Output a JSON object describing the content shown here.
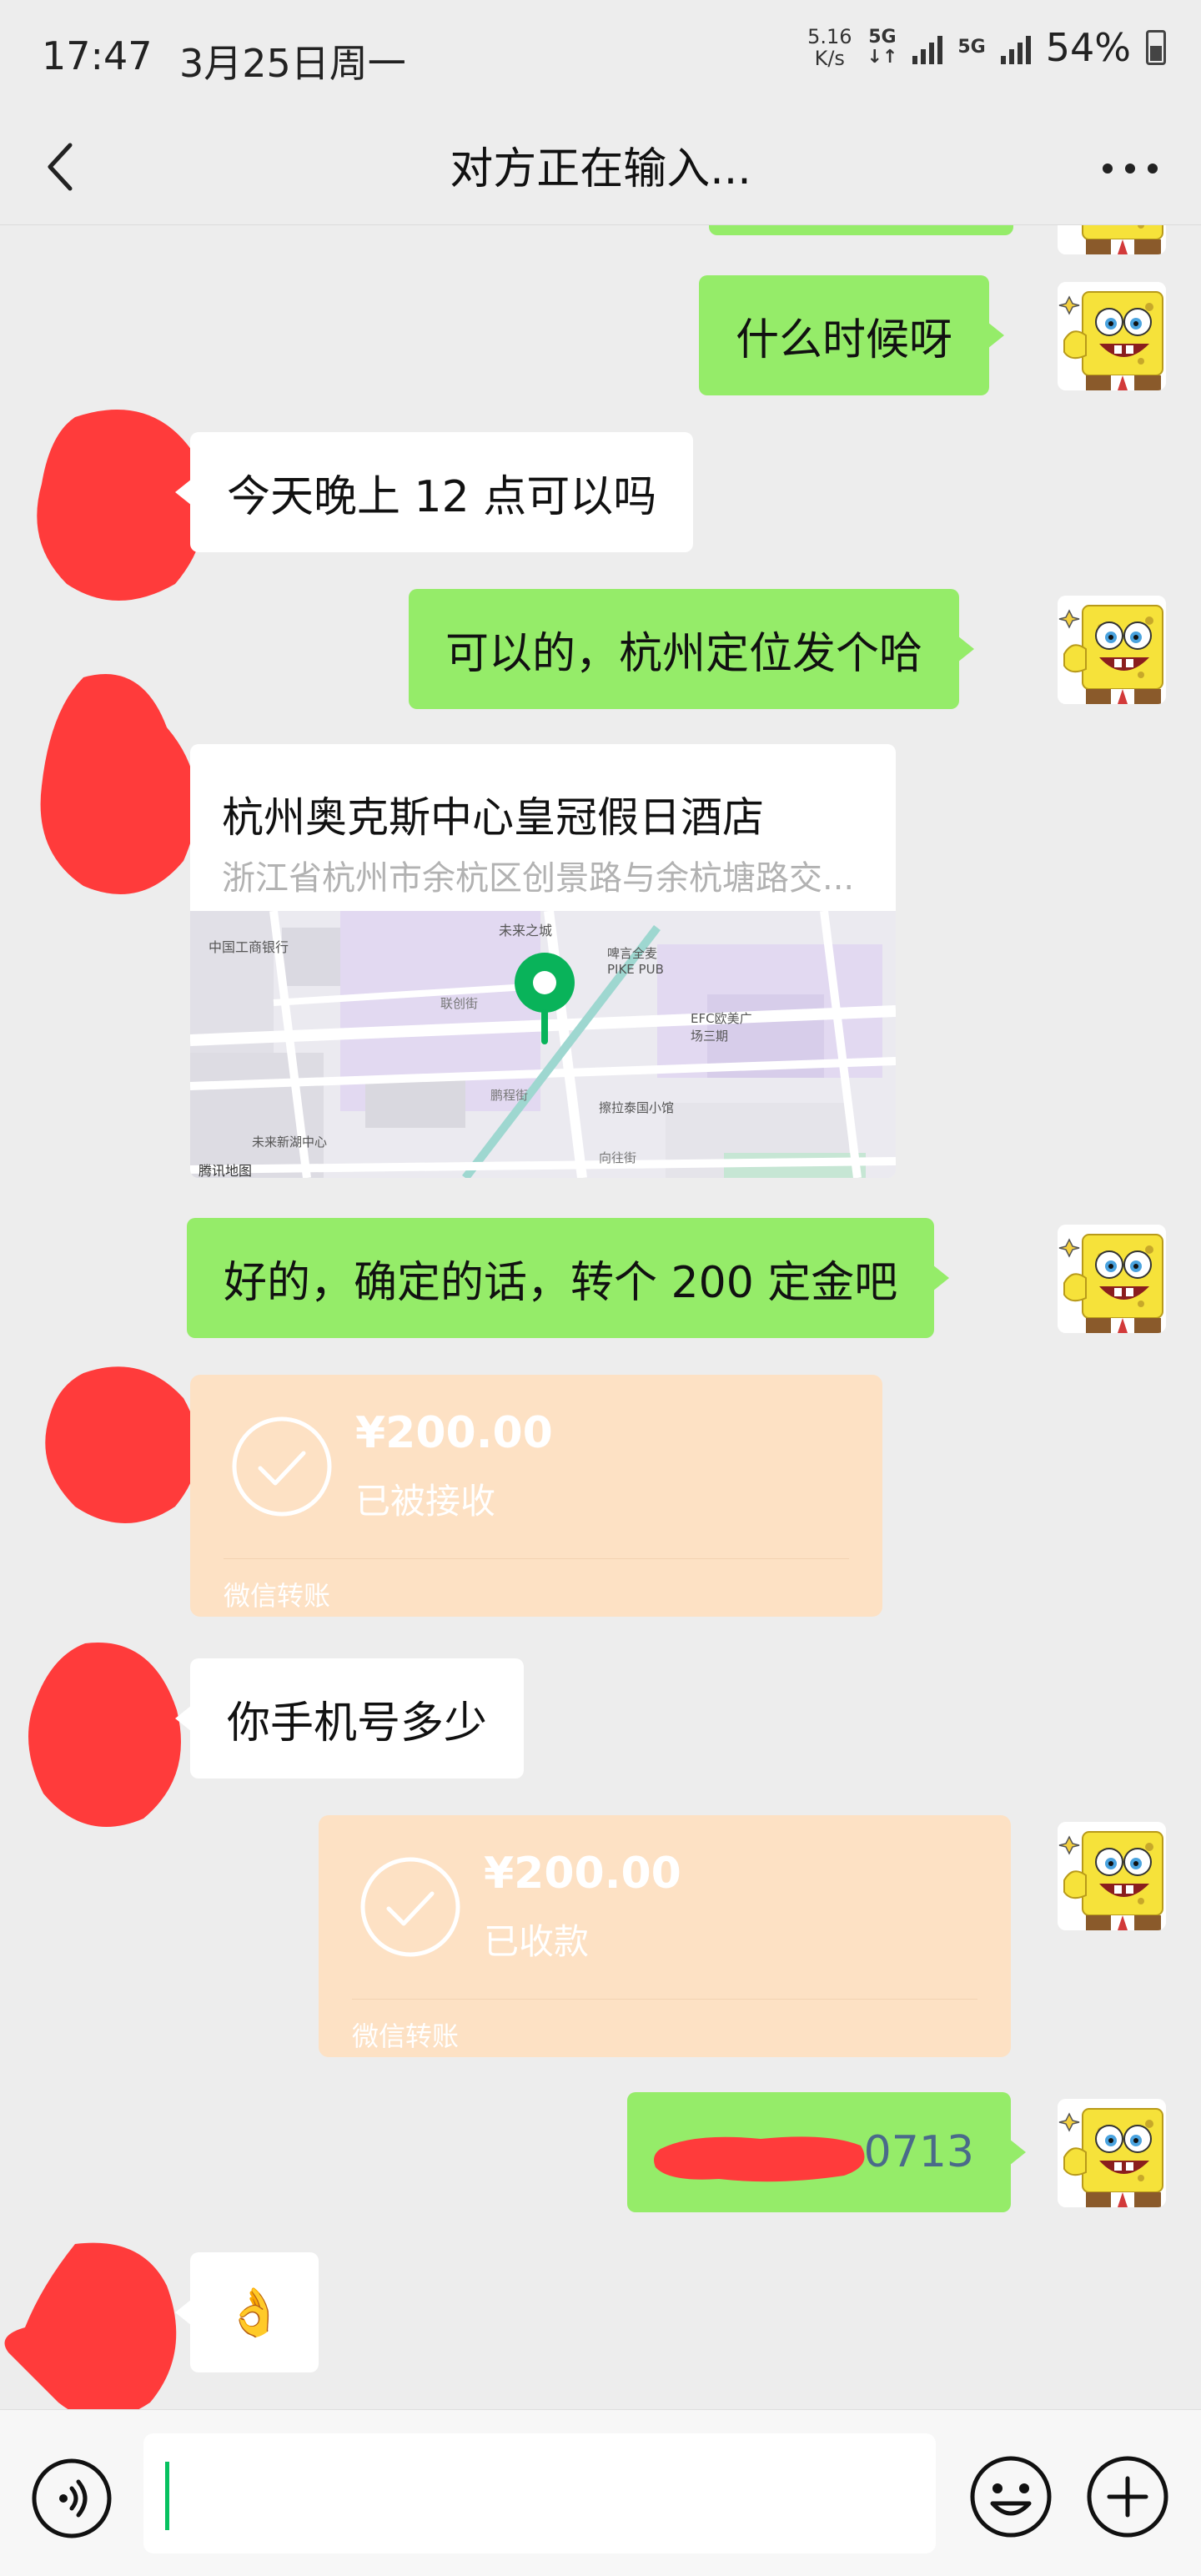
{
  "status_bar": {
    "time": "17:47",
    "date": "3月25日周一",
    "net_speed_value": "5.16",
    "net_speed_unit": "K/s",
    "network_1": "5G",
    "network_2": "5G",
    "battery": "54%"
  },
  "header": {
    "title": "对方正在输入..."
  },
  "messages": [
    {
      "side": "right",
      "type": "text",
      "text": "什么时候呀"
    },
    {
      "side": "left",
      "type": "text",
      "text": "今天晚上 12 点可以吗"
    },
    {
      "side": "right",
      "type": "text",
      "text": "可以的，杭州定位发个哈"
    },
    {
      "side": "left",
      "type": "location",
      "name": "杭州奥克斯中心皇冠假日酒店",
      "address": "浙江省杭州市余杭区创景路与余杭塘路交...",
      "map_labels": {
        "bank": "中国工商银行",
        "center": "未来之城",
        "pub": "啤言全麦 PIKE PUB",
        "plaza": "EFC欧美广场三期",
        "street1": "联创街",
        "street2": "鹏程街",
        "street3": "向往街",
        "shop": "擦拉泰国小馆",
        "newcity": "未来新湖中心",
        "watermark": "腾讯地图"
      }
    },
    {
      "side": "right",
      "type": "text",
      "text": "好的，确定的话，转个 200 定金吧"
    },
    {
      "side": "left",
      "type": "transfer",
      "amount": "¥200.00",
      "status": "已被接收",
      "label": "微信转账"
    },
    {
      "side": "left",
      "type": "text",
      "text": "你手机号多少"
    },
    {
      "side": "right",
      "type": "transfer",
      "amount": "¥200.00",
      "status": "已收款",
      "label": "微信转账"
    },
    {
      "side": "right",
      "type": "text",
      "text": "0713"
    },
    {
      "side": "left",
      "type": "emoji",
      "text": "👌"
    }
  ],
  "colors": {
    "background": "#ededed",
    "bubble_self": "#95ec69",
    "bubble_other": "#ffffff",
    "transfer_card": "#fde1c4",
    "redaction": "#ff3b3b",
    "cursor": "#07c160"
  },
  "icons": {
    "back": "chevron-left-icon",
    "more": "more-dots-icon",
    "voice": "voice-icon",
    "emoji": "emoji-icon",
    "plus": "plus-icon",
    "transfer": "check-circle-icon",
    "location_pin": "map-pin-icon"
  }
}
